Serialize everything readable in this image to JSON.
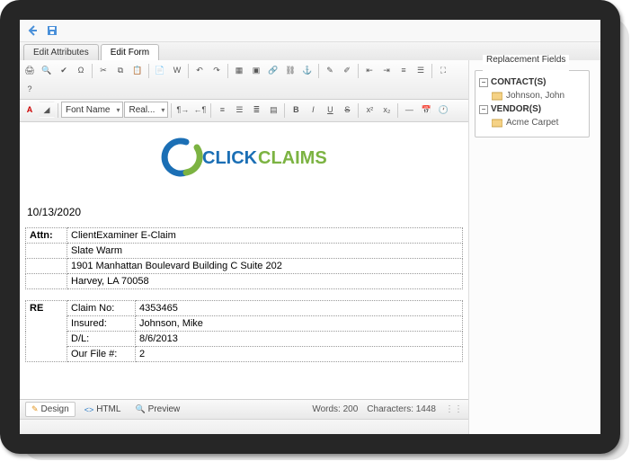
{
  "header": {
    "back_icon": "back-arrow",
    "save_icon": "floppy-disk"
  },
  "tabs": {
    "attributes": "Edit Attributes",
    "form": "Edit Form"
  },
  "toolbar": {
    "font_name_label": "Font Name",
    "size_label": "Real..."
  },
  "document": {
    "date": "10/13/2020",
    "attn_label": "Attn:",
    "attn_line1": "ClientExaminer E-Claim",
    "attn_line2": "Slate Warm",
    "attn_line3": "1901 Manhattan Boulevard Building C Suite 202",
    "attn_line4": "Harvey, LA 70058",
    "re_label": "RE",
    "claim_no_label": "Claim No:",
    "claim_no_value": "4353465",
    "insured_label": "Insured:",
    "insured_value": "Johnson, Mike",
    "dl_label": "D/L:",
    "dl_value": "8/6/2013",
    "ourfile_label": "Our File #:",
    "ourfile_value": "2"
  },
  "modes": {
    "design": "Design",
    "html": "HTML",
    "preview": "Preview"
  },
  "status": {
    "words_label": "Words:",
    "words_value": "200",
    "chars_label": "Characters:",
    "chars_value": "1448"
  },
  "sidebar": {
    "title": "Replacement Fields",
    "groups": {
      "contacts": {
        "label": "CONTACT(S)",
        "items": [
          "Johnson, John"
        ]
      },
      "vendors": {
        "label": "VENDOR(S)",
        "items": [
          "Acme Carpet"
        ]
      }
    }
  },
  "logo": {
    "text1": "CLICK",
    "text2": "CLAIMS"
  }
}
